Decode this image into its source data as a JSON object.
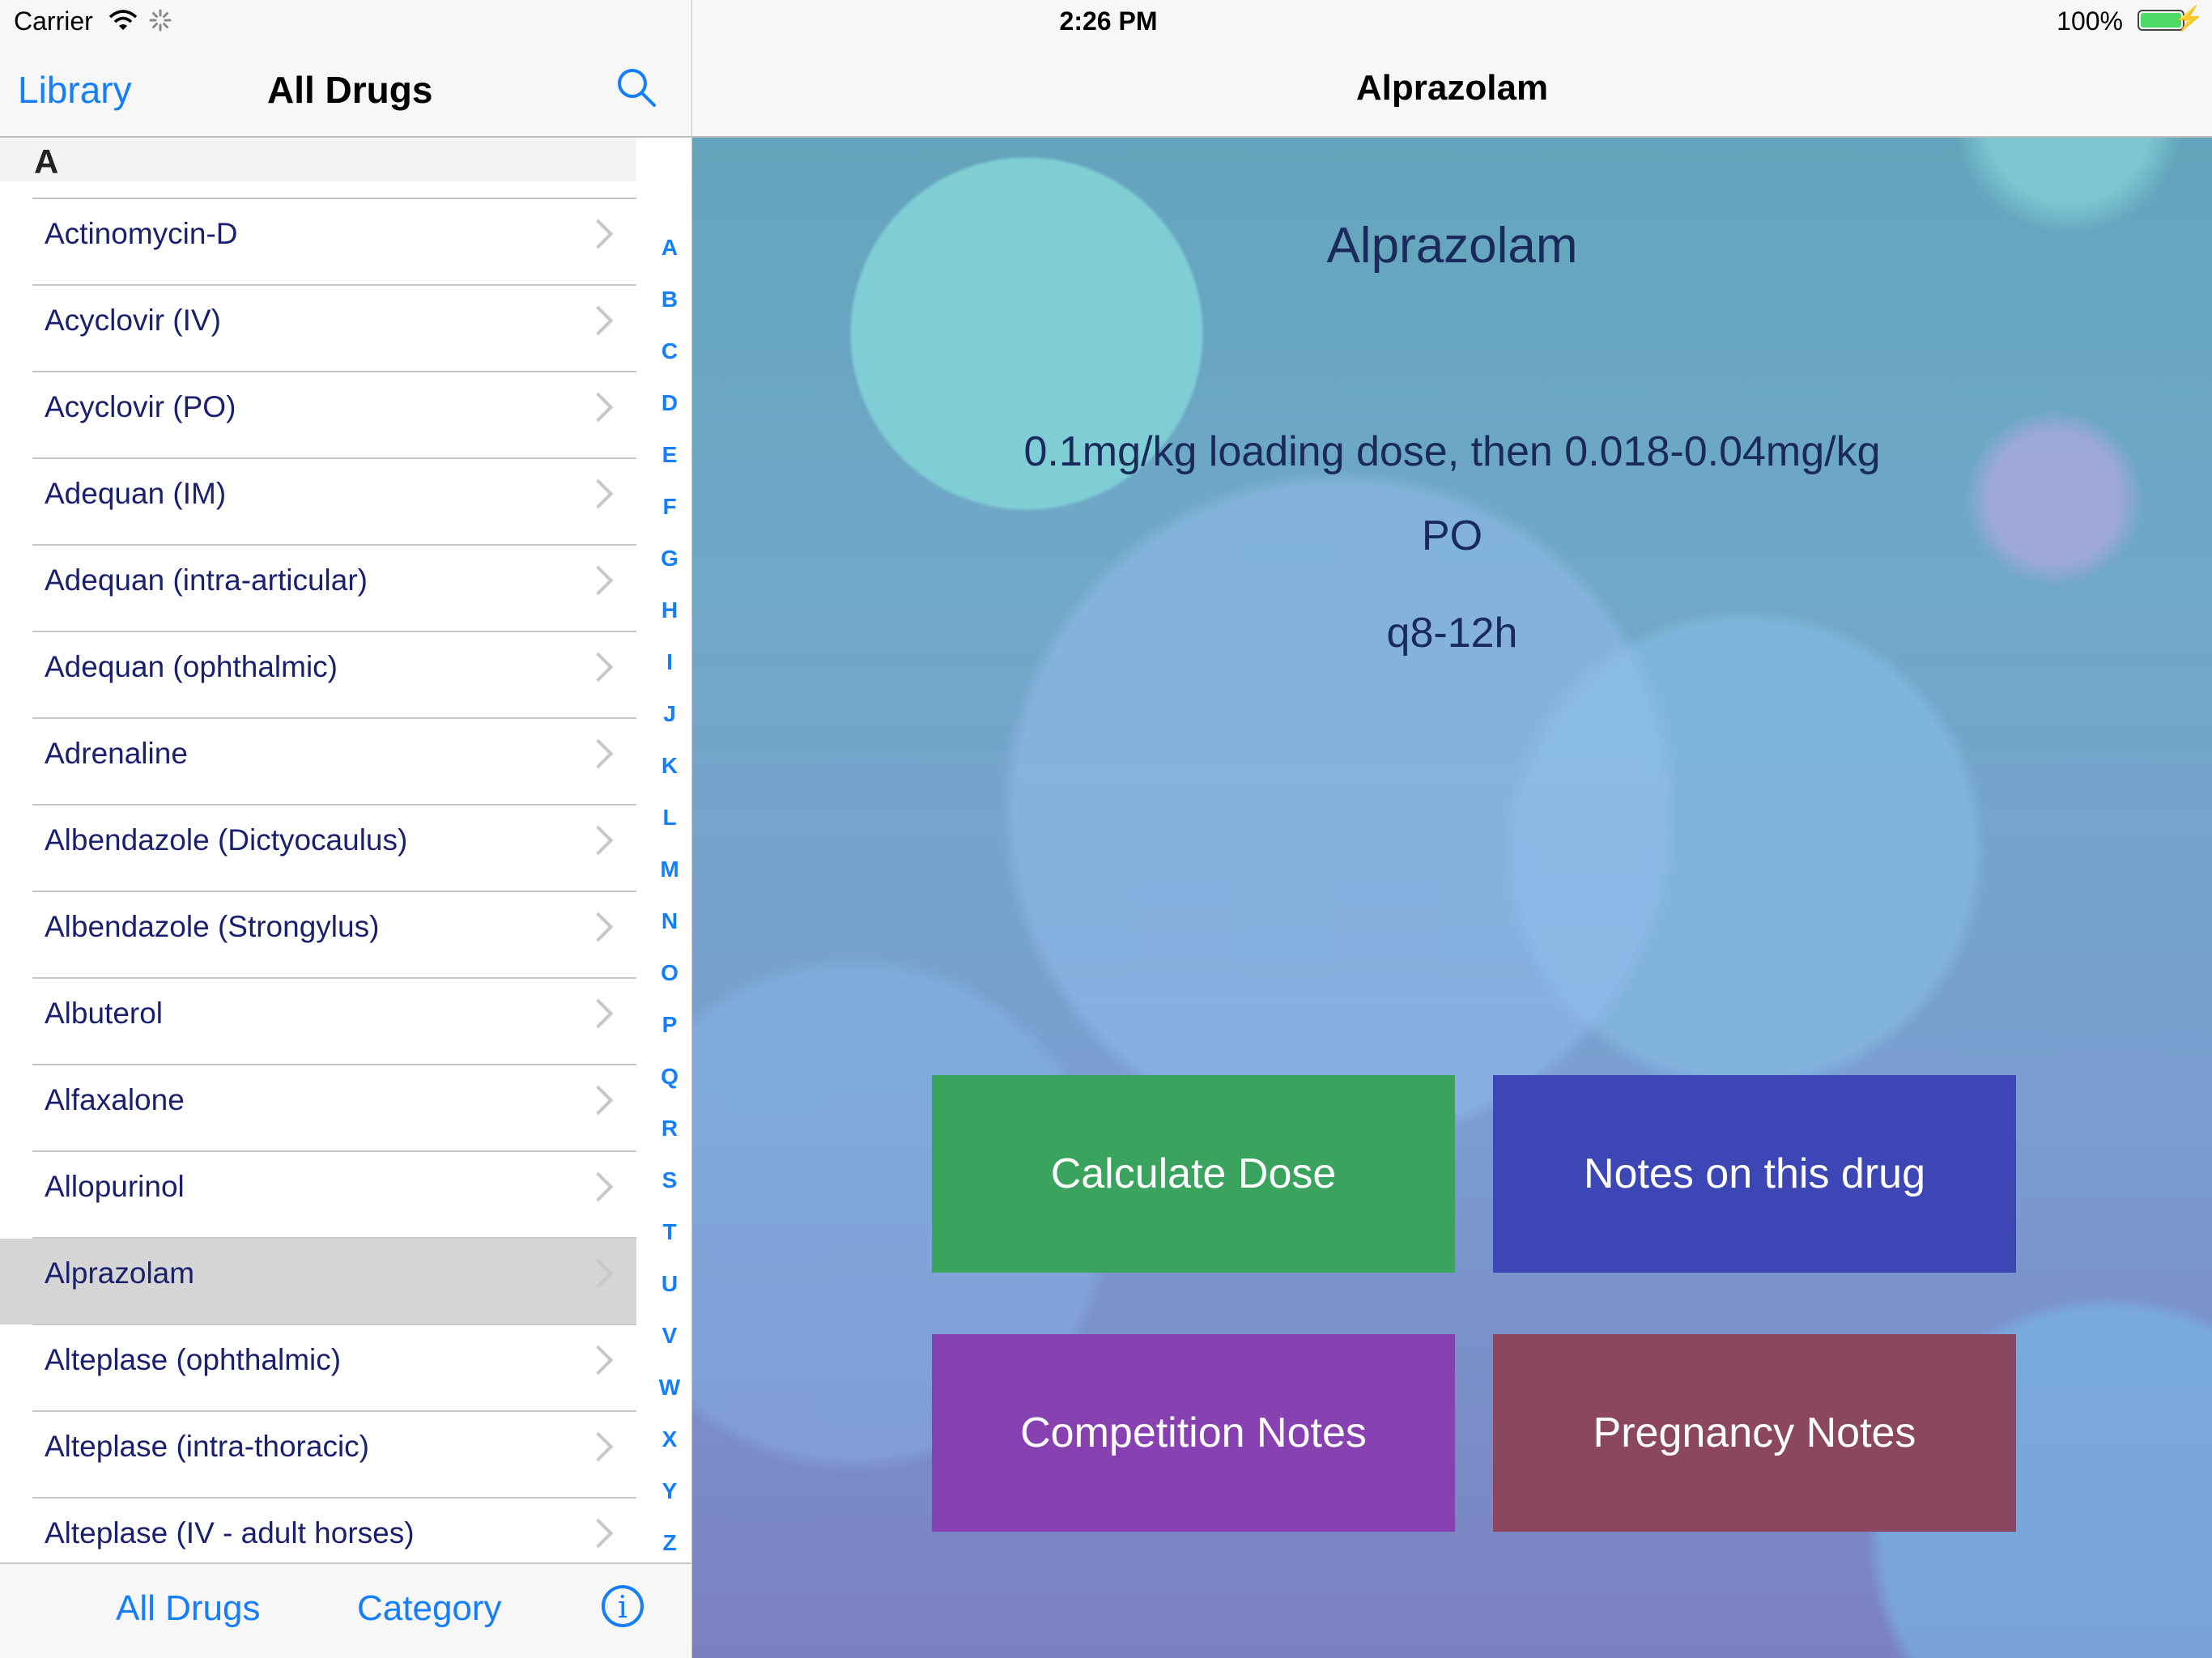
{
  "status_bar": {
    "carrier": "Carrier",
    "time": "2:26 PM",
    "battery": "100%"
  },
  "master": {
    "back_label": "Library",
    "title": "All Drugs",
    "section": "A",
    "items": [
      "Actinomycin-D",
      "Acyclovir (IV)",
      "Acyclovir (PO)",
      "Adequan (IM)",
      "Adequan (intra-articular)",
      "Adequan (ophthalmic)",
      "Adrenaline",
      "Albendazole (Dictyocaulus)",
      "Albendazole (Strongylus)",
      "Albuterol",
      "Alfaxalone",
      "Allopurinol",
      "Alprazolam",
      "Alteplase (ophthalmic)",
      "Alteplase (intra-thoracic)",
      "Alteplase (IV - adult horses)"
    ],
    "selected_item": "Alprazolam",
    "index": [
      "A",
      "B",
      "C",
      "D",
      "E",
      "F",
      "G",
      "H",
      "I",
      "J",
      "K",
      "L",
      "M",
      "N",
      "O",
      "P",
      "Q",
      "R",
      "S",
      "T",
      "U",
      "V",
      "W",
      "X",
      "Y",
      "Z"
    ],
    "tabs": {
      "all_drugs": "All Drugs",
      "category": "Category",
      "info": "i"
    }
  },
  "detail": {
    "nav_title": "Alprazolam",
    "drug_name": "Alprazolam",
    "dose": "0.1mg/kg loading dose, then 0.018-0.04mg/kg",
    "route": "PO",
    "frequency": "q8-12h",
    "buttons": {
      "calculate": "Calculate Dose",
      "notes": "Notes on this drug",
      "competition": "Competition Notes",
      "pregnancy": "Pregnancy Notes"
    }
  },
  "colors": {
    "accent": "#147efb",
    "calculate": "#3aa35e",
    "notes": "#3c46b4",
    "competition": "#8741b0",
    "pregnancy": "#8b4660"
  }
}
